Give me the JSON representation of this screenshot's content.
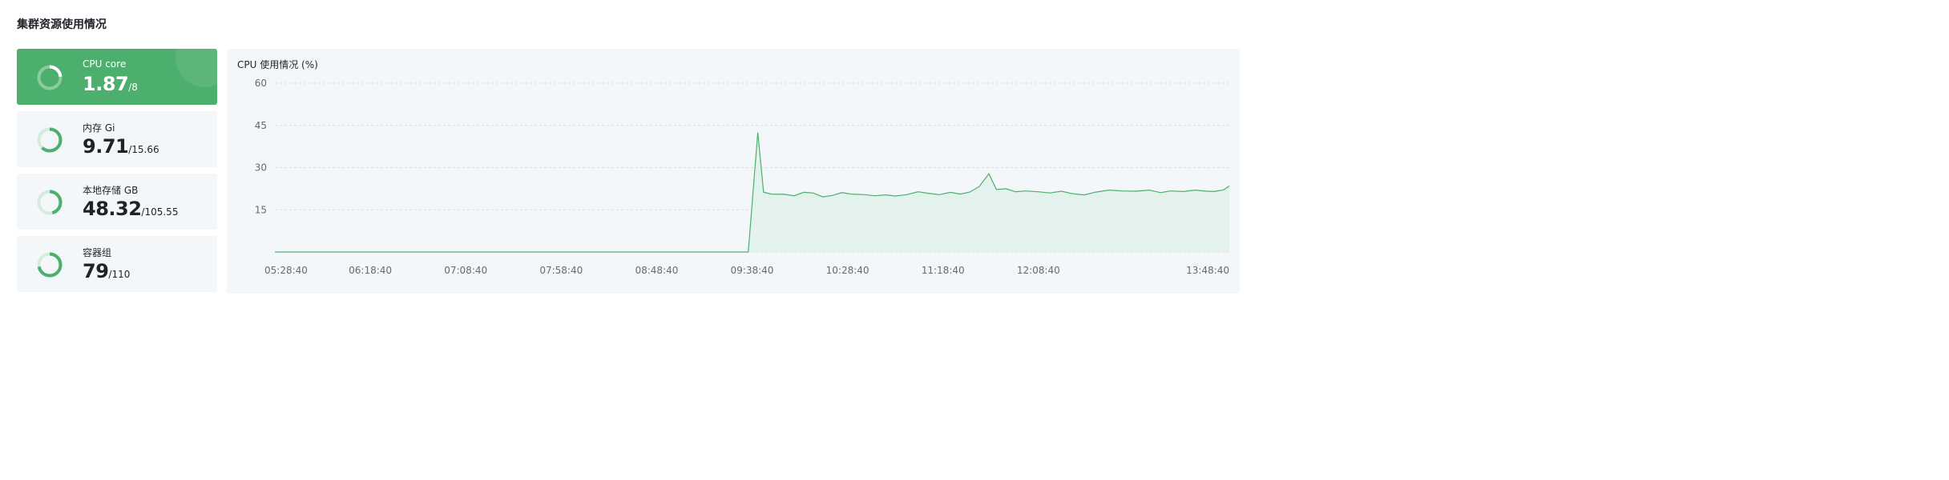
{
  "page": {
    "title": "集群资源使用情况"
  },
  "stats": [
    {
      "label": "CPU core",
      "used": "1.87",
      "total": "/8",
      "used_value": 1.87,
      "total_value": 8,
      "active": true
    },
    {
      "label": "内存 Gi",
      "used": "9.71",
      "total": "/15.66",
      "used_value": 9.71,
      "total_value": 15.66,
      "active": false
    },
    {
      "label": "本地存储 GB",
      "used": "48.32",
      "total": "/105.55",
      "used_value": 48.32,
      "total_value": 105.55,
      "active": false
    },
    {
      "label": "容器组",
      "used": "79",
      "total": "/110",
      "used_value": 79,
      "total_value": 110,
      "active": false
    }
  ],
  "colors": {
    "accent": "#4caf6e",
    "area_fill": "#e3f2ec",
    "grid": "#d9dde3",
    "ring_track": "#d5ebde"
  },
  "chart_data": {
    "type": "area",
    "title": "CPU 使用情况 (%)",
    "xlabel": "",
    "ylabel": "",
    "x_tick_labels": [
      "05:28:40",
      "06:18:40",
      "07:08:40",
      "07:58:40",
      "08:48:40",
      "09:38:40",
      "10:28:40",
      "11:18:40",
      "12:08:40",
      "13:48:40"
    ],
    "y_ticks": [
      15,
      30,
      45,
      60
    ],
    "ylim": [
      0,
      60
    ],
    "xlim": [
      "05:28:40",
      "13:48:40"
    ],
    "grid": "horizontal dashed",
    "series": [
      {
        "points": [
          [
            "05:28:40",
            0
          ],
          [
            "09:36:40",
            0
          ],
          [
            "09:41:40",
            42.5
          ],
          [
            "09:44:40",
            21.3
          ],
          [
            "09:48:40",
            20.6
          ],
          [
            "09:55:40",
            20.5
          ],
          [
            "10:00:40",
            20.0
          ],
          [
            "10:05:40",
            21.2
          ],
          [
            "10:10:40",
            21.0
          ],
          [
            "10:15:40",
            19.6
          ],
          [
            "10:20:40",
            20.1
          ],
          [
            "10:25:40",
            21.1
          ],
          [
            "10:30:40",
            20.6
          ],
          [
            "10:37:40",
            20.4
          ],
          [
            "10:42:40",
            20.0
          ],
          [
            "10:48:40",
            20.3
          ],
          [
            "10:53:40",
            19.9
          ],
          [
            "10:59:40",
            20.4
          ],
          [
            "11:05:40",
            21.4
          ],
          [
            "11:11:40",
            20.8
          ],
          [
            "11:16:40",
            20.4
          ],
          [
            "11:22:40",
            21.2
          ],
          [
            "11:27:40",
            20.6
          ],
          [
            "11:32:40",
            21.3
          ],
          [
            "11:37:40",
            23.3
          ],
          [
            "11:42:40",
            27.8
          ],
          [
            "11:46:40",
            22.2
          ],
          [
            "11:51:40",
            22.5
          ],
          [
            "11:56:40",
            21.4
          ],
          [
            "12:01:40",
            21.7
          ],
          [
            "12:08:40",
            21.4
          ],
          [
            "12:14:40",
            21.0
          ],
          [
            "12:20:40",
            21.6
          ],
          [
            "12:26:40",
            20.7
          ],
          [
            "12:32:40",
            20.3
          ],
          [
            "12:38:40",
            21.3
          ],
          [
            "12:45:40",
            22.0
          ],
          [
            "12:52:40",
            21.7
          ],
          [
            "12:59:40",
            21.6
          ],
          [
            "13:06:40",
            22.0
          ],
          [
            "13:12:40",
            21.1
          ],
          [
            "13:17:40",
            21.7
          ],
          [
            "13:24:40",
            21.5
          ],
          [
            "13:30:40",
            22.0
          ],
          [
            "13:36:40",
            21.6
          ],
          [
            "13:40:40",
            21.5
          ],
          [
            "13:45:40",
            22.1
          ],
          [
            "13:48:40",
            23.5
          ]
        ]
      }
    ]
  }
}
